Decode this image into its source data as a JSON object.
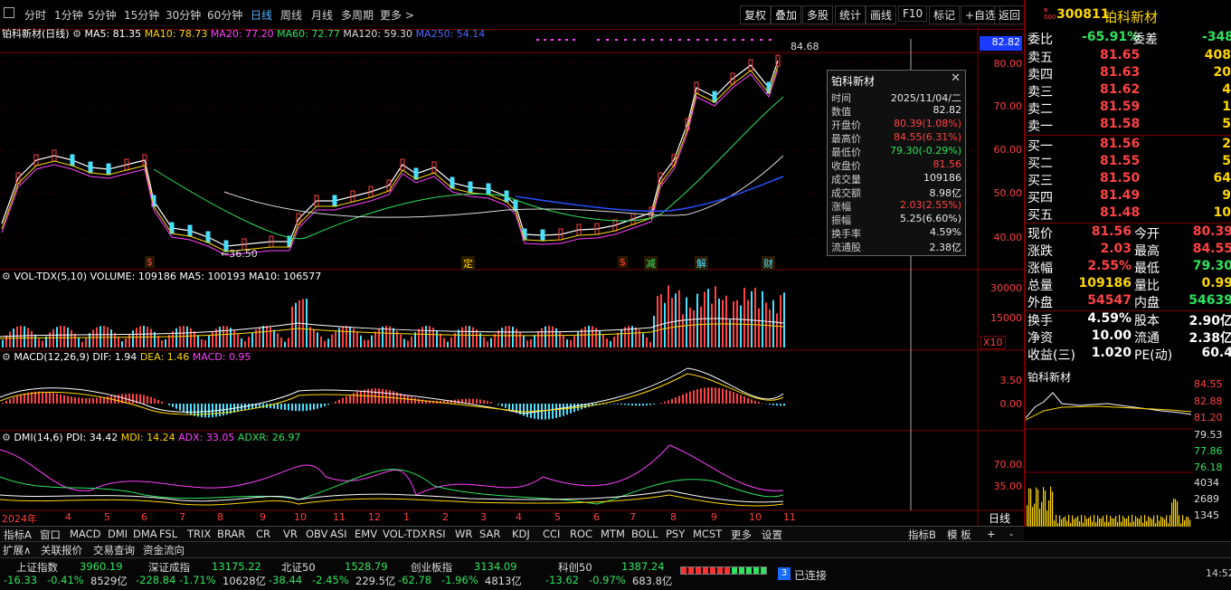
{
  "toolbar": {
    "periods": [
      "分时",
      "1分钟",
      "5分钟",
      "15分钟",
      "30分钟",
      "60分钟",
      "日线",
      "周线",
      "月线",
      "多周期",
      "更多 >"
    ],
    "active": "日线",
    "right": [
      "复权",
      "叠加",
      "多股",
      "统计",
      "画线",
      "F10",
      "标记",
      "+自选",
      "返回"
    ]
  },
  "ma_line": {
    "name": "铂科新材(日线)",
    "ma5": "MA5: 81.35",
    "ma10": "MA10: 78.73",
    "ma20": "MA20: 77.20",
    "ma60": "MA60: 72.77",
    "ma120": "MA120: 59.30",
    "ma250": "MA250: 54.14"
  },
  "price_axis": [
    "80.00",
    "70.00",
    "60.00",
    "50.00",
    "40.00"
  ],
  "price_tag": "82.82",
  "high_label": "84.68",
  "low_label": "36.50",
  "event_marks": [
    "$",
    "定",
    "$",
    "减",
    "解",
    "财"
  ],
  "vol_head": {
    "name": "VOL-TDX(5,10)",
    "volume": "VOLUME: 109186",
    "ma5": "MA5: 100193",
    "ma10": "MA10: 106577"
  },
  "vol_axis": [
    "30000",
    "15000"
  ],
  "vol_unit": "X10",
  "macd_head": {
    "name": "MACD(12,26,9)",
    "dif": "DIF: 1.94",
    "dea": "DEA: 1.46",
    "macd": "MACD: 0.95"
  },
  "macd_axis": [
    "3.50",
    "0.00"
  ],
  "dmi_head": {
    "name": "DMI(14,6)",
    "pdi": "PDI: 34.42",
    "mdi": "MDI: 14.24",
    "adx": "ADX: 33.05",
    "adxr": "ADXR: 26.97"
  },
  "dmi_axis": [
    "70.00",
    "35.00"
  ],
  "x_axis": [
    "2024年",
    "4",
    "5",
    "6",
    "7",
    "8",
    "9",
    "10",
    "11",
    "12",
    "1",
    "2",
    "3",
    "4",
    "5",
    "6",
    "7",
    "8",
    "9",
    "10",
    "11"
  ],
  "x_right": "日线",
  "tooltip": {
    "title": "铂科新材",
    "rows": [
      {
        "k": "时间",
        "v": "2025/11/04/二",
        "c": "#e8e8e8"
      },
      {
        "k": "数值",
        "v": "82.82",
        "c": "#e8e8e8"
      },
      {
        "k": "开盘价",
        "v": "80.39(1.08%)",
        "c": "#ff4242"
      },
      {
        "k": "最高价",
        "v": "84.55(6.31%)",
        "c": "#ff4242"
      },
      {
        "k": "最低价",
        "v": "79.30(-0.29%)",
        "c": "#2ee35e"
      },
      {
        "k": "收盘价",
        "v": "81.56",
        "c": "#ff4242"
      },
      {
        "k": "成交量",
        "v": "109186",
        "c": "#e8e8e8"
      },
      {
        "k": "成交额",
        "v": "8.98亿",
        "c": "#e8e8e8"
      },
      {
        "k": "涨幅",
        "v": "2.03(2.55%)",
        "c": "#ff4242"
      },
      {
        "k": "振幅",
        "v": "5.25(6.60%)",
        "c": "#e8e8e8"
      },
      {
        "k": "换手率",
        "v": "4.59%",
        "c": "#e8e8e8"
      },
      {
        "k": "流通股",
        "v": "2.38亿",
        "c": "#e8e8e8"
      }
    ]
  },
  "quote": {
    "code": "300811",
    "name": "铂科新材",
    "weibi_label": "委比",
    "weibi": "-65.91%",
    "weicha_label": "委差",
    "weicha": "-348",
    "asks": [
      {
        "l": "卖五",
        "p": "81.65",
        "v": "408"
      },
      {
        "l": "卖四",
        "p": "81.63",
        "v": "20"
      },
      {
        "l": "卖三",
        "p": "81.62",
        "v": "4"
      },
      {
        "l": "卖二",
        "p": "81.59",
        "v": "1"
      },
      {
        "l": "卖一",
        "p": "81.58",
        "v": "5"
      }
    ],
    "bids": [
      {
        "l": "买一",
        "p": "81.56",
        "v": "2"
      },
      {
        "l": "买二",
        "p": "81.55",
        "v": "5"
      },
      {
        "l": "买三",
        "p": "81.50",
        "v": "64"
      },
      {
        "l": "买四",
        "p": "81.49",
        "v": "9"
      },
      {
        "l": "买五",
        "p": "81.48",
        "v": "10"
      }
    ],
    "stats": [
      {
        "a": "现价",
        "av": "81.56",
        "ac": "#ff4242",
        "b": "今开",
        "bv": "80.39",
        "bc": "#ff4242"
      },
      {
        "a": "涨跌",
        "av": "2.03",
        "ac": "#ff4242",
        "b": "最高",
        "bv": "84.55",
        "bc": "#ff4242"
      },
      {
        "a": "涨幅",
        "av": "2.55%",
        "ac": "#ff4242",
        "b": "最低",
        "bv": "79.30",
        "bc": "#2ee35e"
      },
      {
        "a": "总量",
        "av": "109186",
        "ac": "#ffd700",
        "b": "量比",
        "bv": "0.99",
        "bc": "#ffd700"
      },
      {
        "a": "外盘",
        "av": "54547",
        "ac": "#ff4242",
        "b": "内盘",
        "bv": "54639",
        "bc": "#2ee35e"
      }
    ],
    "stats2": [
      {
        "a": "换手",
        "av": "4.59%",
        "b": "股本",
        "bv": "2.90亿"
      },
      {
        "a": "净资",
        "av": "10.00",
        "b": "流通",
        "bv": "2.38亿"
      },
      {
        "a": "收益(三)",
        "av": "1.020",
        "b": "PE(动)",
        "bv": "60.4"
      }
    ]
  },
  "mini": {
    "name": "铂科新材",
    "axis": [
      "84.55",
      "82.88",
      "81.20",
      "79.53",
      "77.86",
      "76.18"
    ],
    "axis_colors": [
      "#ff4242",
      "#ff4242",
      "#ff4242",
      "#dddddd",
      "#2ee35e",
      "#2ee35e"
    ],
    "vol_axis": [
      "4034",
      "2689",
      "1345"
    ]
  },
  "tabs": [
    "指标A",
    "窗口",
    "MACD",
    "DMI",
    "DMA",
    "FSL",
    "TRIX",
    "BRAR",
    "CR",
    "VR",
    "OBV",
    "ASI",
    "EMV",
    "VOL-TDX",
    "RSI",
    "WR",
    "SAR",
    "KDJ",
    "CCI",
    "ROC",
    "MTM",
    "BOLL",
    "PSY",
    "MCST",
    "更多",
    "设置"
  ],
  "tabs_right": [
    "指标B",
    "模 板",
    "+",
    "-"
  ],
  "tabs2": [
    "扩展∧",
    "关联报价",
    "交易查询",
    "资金流向"
  ],
  "indices": [
    {
      "n": "上证指数",
      "v": "3960.19",
      "c": "-16.33",
      "p": "-0.41%",
      "a": "8529亿"
    },
    {
      "n": "深证成指",
      "v": "13175.22",
      "c": "-228.84",
      "p": "-1.71%",
      "a": "10628亿"
    },
    {
      "n": "北证50",
      "v": "1528.79",
      "c": "-38.44",
      "p": "-2.45%",
      "a": "229.5亿"
    },
    {
      "n": "创业板指",
      "v": "3134.09",
      "c": "-62.78",
      "p": "-1.96%",
      "a": "4813亿"
    },
    {
      "n": "科创50",
      "v": "1387.24",
      "c": "-13.62",
      "p": "-0.97%",
      "a": "683.8亿"
    }
  ],
  "conn": {
    "badge": "3",
    "text": "已连接"
  },
  "clock": "14:52"
}
